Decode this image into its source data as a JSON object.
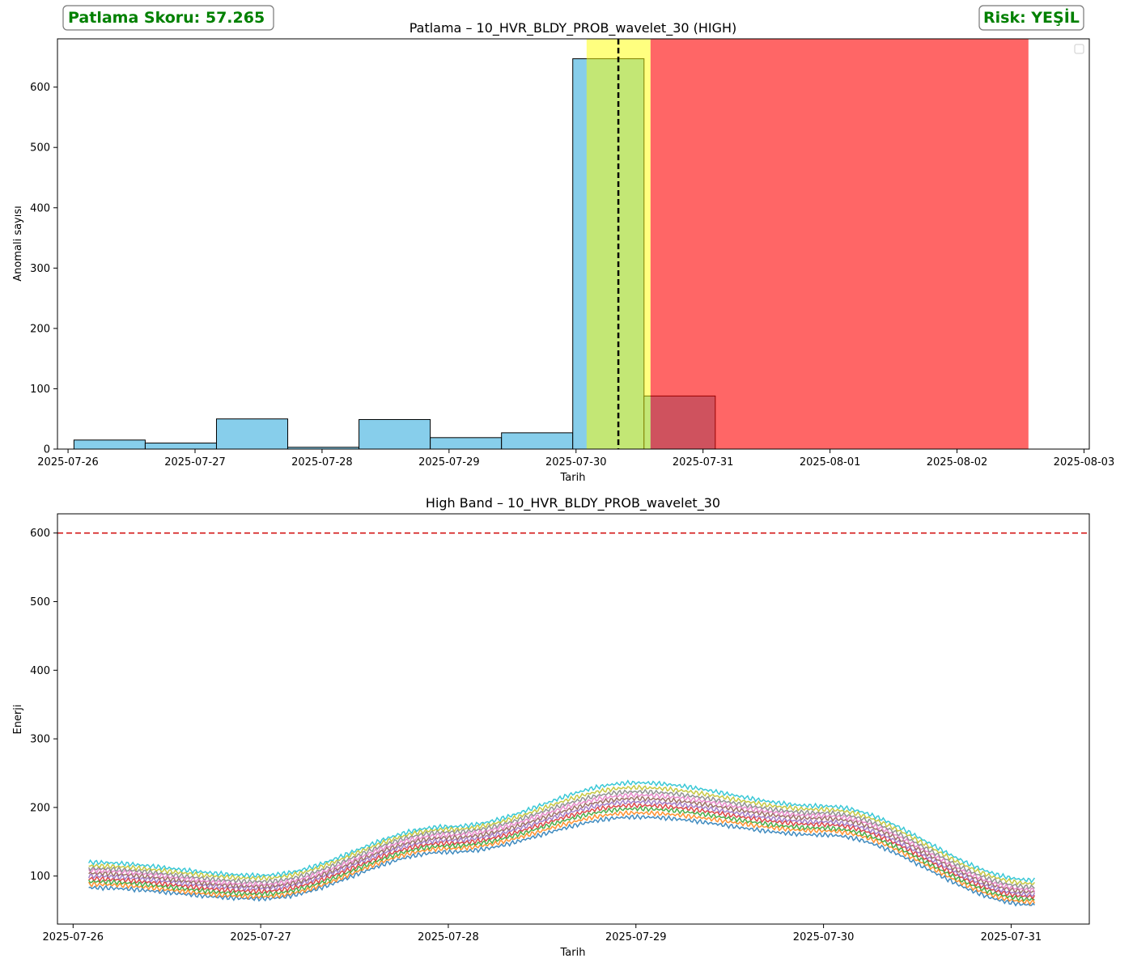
{
  "score_badge": {
    "text": "Patlama Skoru: 57.265",
    "color": "#008000"
  },
  "risk_badge": {
    "text": "Risk: YEŞİL",
    "color": "#008000"
  },
  "chart_data": [
    {
      "type": "bar",
      "title": "Patlama – 10_HVR_BLDY_PROB_wavelet_30 (HIGH)",
      "xlabel": "Tarih",
      "ylabel": "Anomali sayısı",
      "xlim": [
        "2025-07-25 22:00",
        "2025-08-03 01:00"
      ],
      "ylim": [
        0,
        680
      ],
      "x_ticks": [
        "2025-07-26",
        "2025-07-27",
        "2025-07-28",
        "2025-07-29",
        "2025-07-30",
        "2025-07-31",
        "2025-08-01",
        "2025-08-02",
        "2025-08-03"
      ],
      "y_ticks": [
        0,
        100,
        200,
        300,
        400,
        500,
        600
      ],
      "bar_color": "#87ceeb",
      "bars": [
        {
          "start": "2025-07-26 01:07",
          "end": "2025-07-26 14:35",
          "value": 15
        },
        {
          "start": "2025-07-26 14:35",
          "end": "2025-07-27 04:03",
          "value": 10
        },
        {
          "start": "2025-07-27 04:03",
          "end": "2025-07-27 17:31",
          "value": 50
        },
        {
          "start": "2025-07-27 17:31",
          "end": "2025-07-28 06:59",
          "value": 3
        },
        {
          "start": "2025-07-28 06:59",
          "end": "2025-07-28 20:27",
          "value": 49
        },
        {
          "start": "2025-07-28 20:27",
          "end": "2025-07-29 09:55",
          "value": 19
        },
        {
          "start": "2025-07-29 09:55",
          "end": "2025-07-29 23:23",
          "value": 27
        },
        {
          "start": "2025-07-29 23:23",
          "end": "2025-07-30 12:51",
          "value": 647
        },
        {
          "start": "2025-07-30 12:51",
          "end": "2025-07-31 02:19",
          "value": 88
        }
      ],
      "highlight_yellow": {
        "start": "2025-07-30 02:00",
        "end": "2025-07-30 14:05",
        "color": "#ffff00"
      },
      "highlight_red": {
        "start": "2025-07-30 14:05",
        "end": "2025-08-02 13:30",
        "color": "#ff0000"
      },
      "vline": "2025-07-30 08:00",
      "legend": "upper right (empty)"
    },
    {
      "type": "line",
      "title": "High Band – 10_HVR_BLDY_PROB_wavelet_30",
      "xlabel": "Tarih",
      "ylabel": "Enerji",
      "xlim": [
        "2025-07-25 22:00",
        "2025-07-31 10:00"
      ],
      "ylim": [
        30,
        628
      ],
      "x_ticks": [
        "2025-07-26",
        "2025-07-27",
        "2025-07-28",
        "2025-07-29",
        "2025-07-30",
        "2025-07-31"
      ],
      "y_ticks": [
        100,
        200,
        300,
        400,
        500,
        600
      ],
      "threshold": 600,
      "threshold_color": "#d62728",
      "x_start": "2025-07-26 02:00",
      "x_end": "2025-07-31 03:00",
      "grid": false,
      "series": [
        {
          "color": "#1f77b4",
          "samples": [
            [
              "2025-07-26 02:00",
              83
            ],
            [
              "2025-07-27 00:00",
              67
            ],
            [
              "2025-07-28 00:00",
              135
            ],
            [
              "2025-07-29 00:00",
              186
            ],
            [
              "2025-07-30 00:00",
              160
            ],
            [
              "2025-07-31 03:00",
              58
            ]
          ]
        },
        {
          "color": "#ff7f0e",
          "samples": [
            [
              "2025-07-26 02:00",
              88
            ],
            [
              "2025-07-27 00:00",
              70
            ],
            [
              "2025-07-28 00:00",
              140
            ],
            [
              "2025-07-29 00:00",
              192
            ],
            [
              "2025-07-30 00:00",
              166
            ],
            [
              "2025-07-31 03:00",
              62
            ]
          ]
        },
        {
          "color": "#2ca02c",
          "samples": [
            [
              "2025-07-26 02:00",
              92
            ],
            [
              "2025-07-27 00:00",
              74
            ],
            [
              "2025-07-28 00:00",
              144
            ],
            [
              "2025-07-29 00:00",
              198
            ],
            [
              "2025-07-30 00:00",
              170
            ],
            [
              "2025-07-31 03:00",
              66
            ]
          ]
        },
        {
          "color": "#d62728",
          "samples": [
            [
              "2025-07-26 02:00",
              96
            ],
            [
              "2025-07-27 00:00",
              78
            ],
            [
              "2025-07-28 00:00",
              148
            ],
            [
              "2025-07-29 00:00",
              203
            ],
            [
              "2025-07-30 00:00",
              175
            ],
            [
              "2025-07-31 03:00",
              70
            ]
          ]
        },
        {
          "color": "#9467bd",
          "samples": [
            [
              "2025-07-26 02:00",
              100
            ],
            [
              "2025-07-27 00:00",
              82
            ],
            [
              "2025-07-28 00:00",
              152
            ],
            [
              "2025-07-29 00:00",
              208
            ],
            [
              "2025-07-30 00:00",
              179
            ],
            [
              "2025-07-31 03:00",
              73
            ]
          ]
        },
        {
          "color": "#8c564b",
          "samples": [
            [
              "2025-07-26 02:00",
              104
            ],
            [
              "2025-07-27 00:00",
              85
            ],
            [
              "2025-07-28 00:00",
              156
            ],
            [
              "2025-07-29 00:00",
              213
            ],
            [
              "2025-07-30 00:00",
              184
            ],
            [
              "2025-07-31 03:00",
              77
            ]
          ]
        },
        {
          "color": "#e377c2",
          "samples": [
            [
              "2025-07-26 02:00",
              108
            ],
            [
              "2025-07-27 00:00",
              88
            ],
            [
              "2025-07-28 00:00",
              160
            ],
            [
              "2025-07-29 00:00",
              218
            ],
            [
              "2025-07-30 00:00",
              188
            ],
            [
              "2025-07-31 03:00",
              80
            ]
          ]
        },
        {
          "color": "#7f7f7f",
          "samples": [
            [
              "2025-07-26 02:00",
              111
            ],
            [
              "2025-07-27 00:00",
              92
            ],
            [
              "2025-07-28 00:00",
              164
            ],
            [
              "2025-07-29 00:00",
              223
            ],
            [
              "2025-07-30 00:00",
              192
            ],
            [
              "2025-07-31 03:00",
              84
            ]
          ]
        },
        {
          "color": "#bcbd22",
          "samples": [
            [
              "2025-07-26 02:00",
              115
            ],
            [
              "2025-07-27 00:00",
              97
            ],
            [
              "2025-07-28 00:00",
              168
            ],
            [
              "2025-07-29 00:00",
              229
            ],
            [
              "2025-07-30 00:00",
              197
            ],
            [
              "2025-07-31 03:00",
              89
            ]
          ]
        },
        {
          "color": "#17becf",
          "samples": [
            [
              "2025-07-26 02:00",
              120
            ],
            [
              "2025-07-27 00:00",
              101
            ],
            [
              "2025-07-28 00:00",
              172
            ],
            [
              "2025-07-29 00:00",
              236
            ],
            [
              "2025-07-30 00:00",
              202
            ],
            [
              "2025-07-31 03:00",
              94
            ]
          ]
        }
      ]
    }
  ]
}
